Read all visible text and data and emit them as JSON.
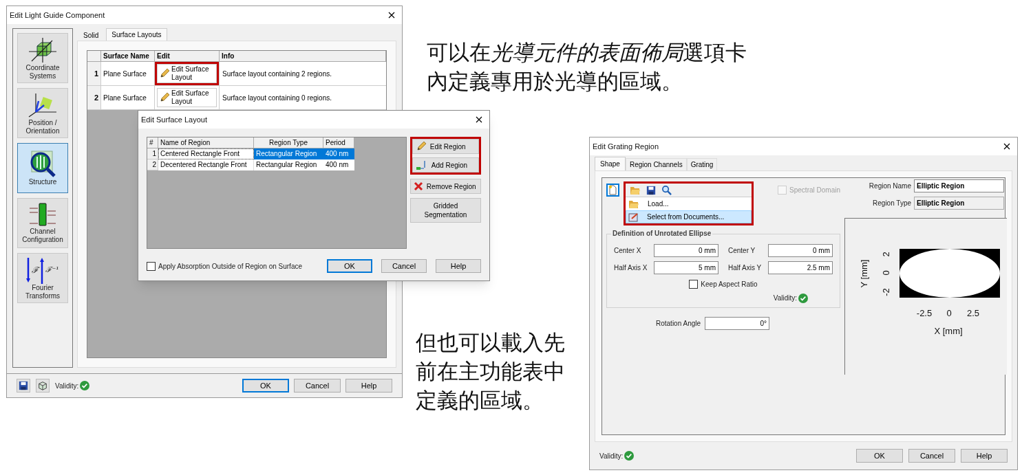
{
  "notes": [
    {
      "parts": [
        {
          "text": "可以在",
          "italic": false
        },
        {
          "text": "光導元件的表面佈局",
          "italic": true
        },
        {
          "text": "選項卡內定義專用於光導的區域。",
          "italic": false
        }
      ]
    },
    {
      "text": "但也可以載入先前在主功能表中定義的區域。"
    }
  ],
  "light_guide_window": {
    "title": "Edit Light Guide Component",
    "sidebar": [
      {
        "label": "Coordinate Systems",
        "selected": false
      },
      {
        "label": "Position / Orientation",
        "selected": false
      },
      {
        "label": "Structure",
        "selected": true
      },
      {
        "label": "Channel Configuration",
        "selected": false
      },
      {
        "label": "Fourier Transforms",
        "selected": false,
        "glyphs": [
          "ℱ",
          "ℱ⁻¹"
        ]
      }
    ],
    "tabs": [
      {
        "label": "Solid",
        "selected": false
      },
      {
        "label": "Surface Layouts",
        "selected": true
      }
    ],
    "table": {
      "columns": [
        "Surface Name",
        "Edit",
        "Info"
      ],
      "rows": [
        {
          "number": "1",
          "surface_name": "Plane Surface",
          "edit": "Edit Surface Layout",
          "highlighted": true,
          "info": "Surface layout containing 2 regions."
        },
        {
          "number": "2",
          "surface_name": "Plane Surface",
          "edit": "Edit Surface Layout",
          "highlighted": false,
          "info": "Surface layout containing 0 regions."
        }
      ]
    },
    "validity": {
      "label": "Validity:",
      "valid": true
    },
    "buttons": [
      {
        "label": "OK",
        "default": true
      },
      {
        "label": "Cancel",
        "default": false
      },
      {
        "label": "Help",
        "default": false
      }
    ]
  },
  "surface_layout_dialog": {
    "title": "Edit Surface Layout",
    "table": {
      "columns": [
        "#",
        "Name of Region",
        "Region Type",
        "Period"
      ],
      "rows": [
        {
          "number": "1",
          "name": "Centered Rectangle Front",
          "type": "Rectangular Region",
          "period": "400 nm",
          "selected": true
        },
        {
          "number": "2",
          "name": "Decentered Rectangle Front",
          "type": "Rectangular Region",
          "period": "400 nm",
          "selected": false
        }
      ]
    },
    "actions": [
      {
        "label": "Edit Region",
        "highlighted": true
      },
      {
        "label": "Add Region",
        "highlighted": true
      },
      {
        "label": "Remove Region",
        "highlighted": false
      },
      {
        "label": "Gridded Segmentation",
        "highlighted": false
      }
    ],
    "absorption": {
      "label": "Apply Absorption Outside of Region on Surface",
      "checked": false
    },
    "buttons": [
      {
        "label": "OK",
        "default": true
      },
      {
        "label": "Cancel",
        "default": false
      },
      {
        "label": "Help",
        "default": false
      }
    ]
  },
  "grating_window": {
    "title": "Edit Grating Region",
    "tabs": [
      {
        "label": "Shape",
        "selected": true
      },
      {
        "label": "Region Channels",
        "selected": false
      },
      {
        "label": "Grating",
        "selected": false
      }
    ],
    "file_menu": {
      "highlighted": true,
      "items": [
        {
          "label": "Load...",
          "selected": false
        },
        {
          "label": "Select from Documents...",
          "selected": true
        }
      ]
    },
    "spectral_domain": {
      "label": "Spectral Domain",
      "checked": false,
      "disabled": true
    },
    "region_name": {
      "label": "Region Name",
      "value": "Elliptic Region",
      "readonly": false
    },
    "region_type": {
      "label": "Region Type",
      "value": "Elliptic Region",
      "readonly": true
    },
    "ellipse": {
      "title": "Definition of Unrotated Ellipse",
      "fields": [
        {
          "label": "Center X",
          "value": "0 mm"
        },
        {
          "label": "Center Y",
          "value": "0 mm"
        },
        {
          "label": "Half Axis X",
          "value": "5 mm"
        },
        {
          "label": "Half Axis Y",
          "value": "2.5 mm"
        }
      ],
      "keep_aspect": {
        "label": "Keep Aspect Ratio",
        "checked": false
      },
      "validity": {
        "label": "Validity:",
        "valid": true
      }
    },
    "rotation": {
      "label": "Rotation Angle",
      "value": "0°"
    },
    "plot": {
      "xlabel": "X [mm]",
      "ylabel": "Y [mm]",
      "xticks": [
        "-2.5",
        "0",
        "2.5"
      ],
      "yticks": [
        "2",
        "0",
        "-2"
      ]
    },
    "validity": {
      "label": "Validity:",
      "valid": true
    },
    "buttons": [
      {
        "label": "OK",
        "default": false
      },
      {
        "label": "Cancel",
        "default": false
      },
      {
        "label": "Help",
        "default": false
      }
    ]
  }
}
